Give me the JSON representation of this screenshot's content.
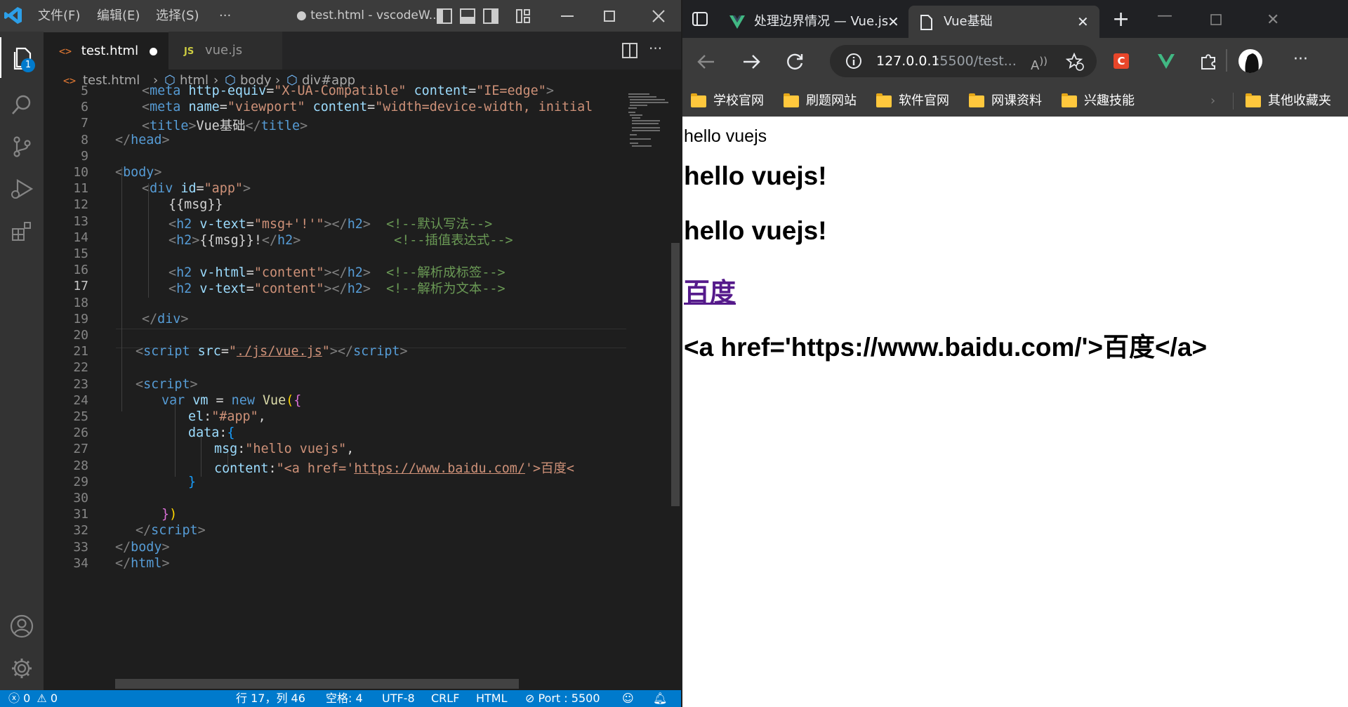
{
  "vscode": {
    "menu": [
      "文件(F)",
      "编辑(E)",
      "选择(S)",
      "···"
    ],
    "window_title": "● test.html - vscodeW...",
    "badge_count": "1",
    "tabs": [
      {
        "label": "test.html",
        "icon": "<>",
        "modified": true,
        "active": true
      },
      {
        "label": "vue.js",
        "icon": "JS",
        "modified": false,
        "active": false
      }
    ],
    "breadcrumb": [
      "test.html",
      "html",
      "body",
      "div#app"
    ],
    "code_lines": [
      {
        "n": "5"
      },
      {
        "n": "6"
      },
      {
        "n": "7"
      },
      {
        "n": "8"
      },
      {
        "n": "9"
      },
      {
        "n": "10"
      },
      {
        "n": "11"
      },
      {
        "n": "12"
      },
      {
        "n": "13"
      },
      {
        "n": "14"
      },
      {
        "n": "15"
      },
      {
        "n": "16"
      },
      {
        "n": "17"
      },
      {
        "n": "18"
      },
      {
        "n": "19"
      },
      {
        "n": "20"
      },
      {
        "n": "21"
      },
      {
        "n": "22"
      },
      {
        "n": "23"
      },
      {
        "n": "24"
      },
      {
        "n": "25"
      },
      {
        "n": "26"
      },
      {
        "n": "27"
      },
      {
        "n": "28"
      },
      {
        "n": "29"
      },
      {
        "n": "30"
      },
      {
        "n": "31"
      },
      {
        "n": "32"
      },
      {
        "n": "33"
      },
      {
        "n": "34"
      }
    ],
    "code": {
      "l5": [
        "<",
        "meta",
        " ",
        "http-equiv",
        "=",
        "\"X-UA-Compatible\"",
        " ",
        "content",
        "=",
        "\"IE=edge\"",
        ">"
      ],
      "l6": [
        "<",
        "meta",
        " ",
        "name",
        "=",
        "\"viewport\"",
        " ",
        "content",
        "=",
        "\"width=device-width, initial"
      ],
      "l7": [
        "<",
        "title",
        ">",
        "Vue基础",
        "</",
        "title",
        ">"
      ],
      "l8": [
        "</",
        "head",
        ">"
      ],
      "l10": [
        "<",
        "body",
        ">"
      ],
      "l11": [
        "<",
        "div",
        " ",
        "id",
        "=",
        "\"app\"",
        ">"
      ],
      "l12": "{{msg}}",
      "l13": [
        "<",
        "h2",
        " ",
        "v-text",
        "=",
        "\"msg+'!'\"",
        "></",
        "h2",
        ">",
        "  <!--默认写法-->"
      ],
      "l14": [
        "<",
        "h2",
        ">",
        "{{msg}}!",
        "</",
        "h2",
        ">",
        "            <!--插值表达式-->"
      ],
      "l16": [
        "<",
        "h2",
        " ",
        "v-html",
        "=",
        "\"content\"",
        "></",
        "h2",
        ">",
        "  <!--解析成标签-->"
      ],
      "l17": [
        "<",
        "h2",
        " ",
        "v-text",
        "=",
        "\"content\"",
        "></",
        "h2",
        ">",
        "  <!--解析为文本-->"
      ],
      "l19": [
        "</",
        "div",
        ">"
      ],
      "l21": [
        "<",
        "script",
        " ",
        "src",
        "=",
        "\"",
        "./js/vue.js",
        "\"",
        "></",
        "script",
        ">"
      ],
      "l23": [
        "<",
        "script",
        ">"
      ],
      "l24": [
        "var",
        " ",
        "vm",
        " = ",
        "new",
        " ",
        "Vue",
        "(",
        "{"
      ],
      "l25": [
        "el",
        ":",
        "\"#app\"",
        ","
      ],
      "l26": [
        "data",
        ":",
        "{"
      ],
      "l27": [
        "msg",
        ":",
        "\"hello vuejs\"",
        ","
      ],
      "l28": [
        "content",
        ":",
        "\"<a href='",
        "https://www.baidu.com/",
        "'>百度<"
      ],
      "l29": "}",
      "l31": [
        "}",
        ")"
      ],
      "l32": [
        "</",
        "script",
        ">"
      ],
      "l33": [
        "</",
        "body",
        ">"
      ],
      "l34": [
        "</",
        "html",
        ">"
      ]
    },
    "status": {
      "errors": "0",
      "warnings": "0",
      "position": "行 17，列 46",
      "spaces": "空格: 4",
      "encoding": "UTF-8",
      "eol": "CRLF",
      "language": "HTML",
      "port": "Port : 5500"
    }
  },
  "browser": {
    "tabs": [
      {
        "label": "处理边界情况 — Vue.js",
        "active": false
      },
      {
        "label": "Vue基础",
        "active": true
      }
    ],
    "address": "127.0.0.1:5500/test...",
    "address_host": "127.0.0.1",
    "address_rest": ":5500/test...",
    "bookmarks": [
      "学校官网",
      "刷题网站",
      "软件官网",
      "网课资料",
      "兴趣技能"
    ],
    "other_bookmarks": "其他收藏夹",
    "page": {
      "line1": "hello vuejs",
      "h2_1": "hello vuejs!",
      "h2_2": "hello vuejs!",
      "link": "百度",
      "h2_4": "<a href='https://www.baidu.com/'>百度</a>"
    }
  },
  "colors": {
    "vscode_bg": "#1e1e1e",
    "statusbar": "#007acc",
    "link_visited": "#551a8b"
  }
}
